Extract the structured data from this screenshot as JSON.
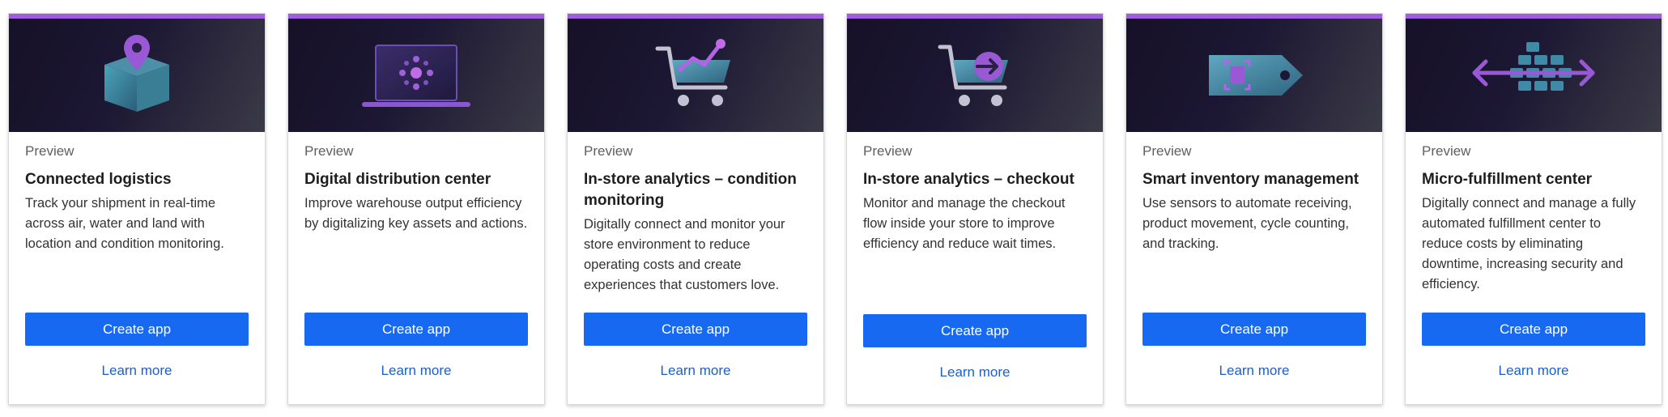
{
  "cards": [
    {
      "status": "Preview",
      "title": "Connected logistics",
      "description": "Track your shipment in real-time across air, water and land with location and condition monitoring.",
      "create_label": "Create app",
      "learn_label": "Learn more",
      "icon": "package-location-icon"
    },
    {
      "status": "Preview",
      "title": "Digital distribution center",
      "description": "Improve warehouse output efficiency by digitalizing key assets and actions.",
      "create_label": "Create app",
      "learn_label": "Learn more",
      "icon": "laptop-network-icon"
    },
    {
      "status": "Preview",
      "title": "In-store analytics – condition monitoring",
      "description": "Digitally connect and monitor your store environment to reduce operating costs and create experiences that customers love.",
      "create_label": "Create app",
      "learn_label": "Learn more",
      "icon": "cart-chart-icon"
    },
    {
      "status": "Preview",
      "title": "In-store analytics – checkout",
      "description": "Monitor and manage the checkout flow inside your store to improve efficiency and reduce wait times.",
      "create_label": "Create app",
      "learn_label": "Learn more",
      "icon": "cart-arrow-icon"
    },
    {
      "status": "Preview",
      "title": "Smart inventory management",
      "description": "Use sensors to automate receiving, product movement, cycle counting, and tracking.",
      "create_label": "Create app",
      "learn_label": "Learn more",
      "icon": "tag-scan-icon"
    },
    {
      "status": "Preview",
      "title": "Micro-fulfillment center",
      "description": "Digitally connect and manage a fully automated fulfillment center to reduce costs by eliminating downtime, increasing security and efficiency.",
      "create_label": "Create app",
      "learn_label": "Learn more",
      "icon": "boxes-arrows-icon"
    }
  ],
  "colors": {
    "accent_bar": "#a25ce0",
    "button": "#1869f2",
    "link": "#1c5fc9"
  }
}
